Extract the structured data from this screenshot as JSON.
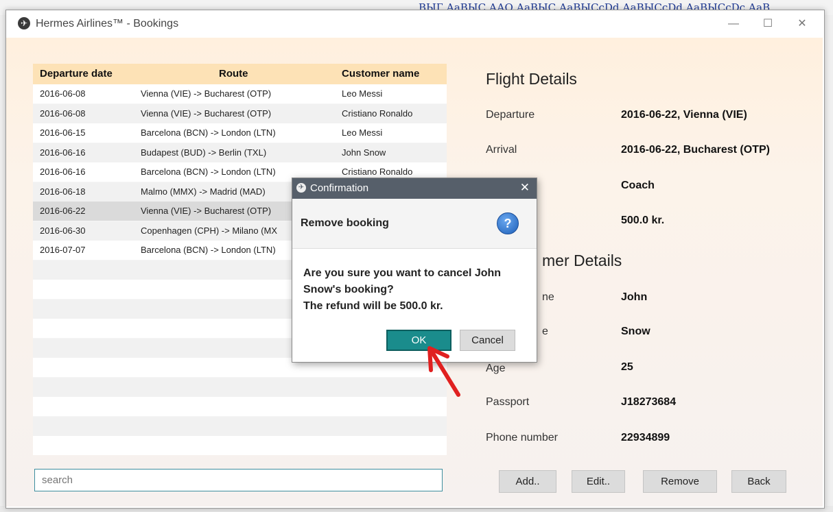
{
  "backdrop": {
    "top_text": "ВЫГ АаВЫС ААО АаВЫС АаВЫСсDd АаВЫСсDd АаВЫСсDс АаВ"
  },
  "window": {
    "title": "Hermes Airlines™  -  Bookings",
    "minimize": "—",
    "maximize": "☐",
    "close": "✕"
  },
  "table": {
    "columns": [
      "Departure date",
      "Route",
      "Customer name"
    ],
    "rows": [
      {
        "date": "2016-06-08",
        "route": "Vienna (VIE) -> Bucharest (OTP)",
        "customer": "Leo Messi"
      },
      {
        "date": "2016-06-08",
        "route": "Vienna (VIE) -> Bucharest (OTP)",
        "customer": "Cristiano Ronaldo"
      },
      {
        "date": "2016-06-15",
        "route": "Barcelona (BCN) -> London (LTN)",
        "customer": "Leo Messi"
      },
      {
        "date": "2016-06-16",
        "route": "Budapest (BUD) -> Berlin (TXL)",
        "customer": "John Snow"
      },
      {
        "date": "2016-06-16",
        "route": "Barcelona (BCN) -> London (LTN)",
        "customer": "Cristiano Ronaldo"
      },
      {
        "date": "2016-06-18",
        "route": "Malmo (MMX) -> Madrid (MAD)",
        "customer": ""
      },
      {
        "date": "2016-06-22",
        "route": "Vienna (VIE) -> Bucharest (OTP)",
        "customer": ""
      },
      {
        "date": "2016-06-30",
        "route": "Copenhagen (CPH) -> Milano (MX",
        "customer": ""
      },
      {
        "date": "2016-07-07",
        "route": "Barcelona (BCN) -> London (LTN)",
        "customer": ""
      }
    ],
    "selected_index": 6
  },
  "search": {
    "placeholder": "search"
  },
  "flight_details": {
    "title": "Flight Details",
    "departure_label": "Departure",
    "departure_value": "2016-06-22, Vienna (VIE)",
    "arrival_label": "Arrival",
    "arrival_value": "2016-06-22, Bucharest (OTP)",
    "class_value": "Coach",
    "price_value": "500.0 kr."
  },
  "customer_details": {
    "title": "mer Details",
    "first_name_label": "ne",
    "first_name_value": "John",
    "last_name_label": "e",
    "last_name_value": "Snow",
    "age_label": "Age",
    "age_value": "25",
    "passport_label": "Passport",
    "passport_value": "J18273684",
    "phone_label": "Phone number",
    "phone_value": "22934899"
  },
  "buttons": {
    "add": "Add..",
    "edit": "Edit..",
    "remove": "Remove",
    "back": "Back"
  },
  "dialog": {
    "title": "Confirmation",
    "close": "✕",
    "header": "Remove booking",
    "help_icon": "?",
    "message_lines": [
      "Are you sure you want to cancel John",
      "Snow's booking?",
      "The refund will be 500.0 kr."
    ],
    "ok": "OK",
    "cancel": "Cancel"
  },
  "colors": {
    "header_bg": "#fde2b6",
    "ok_button": "#1a8c8c",
    "dialog_titlebar": "#565f6a",
    "annotation_arrow": "#e02020"
  }
}
